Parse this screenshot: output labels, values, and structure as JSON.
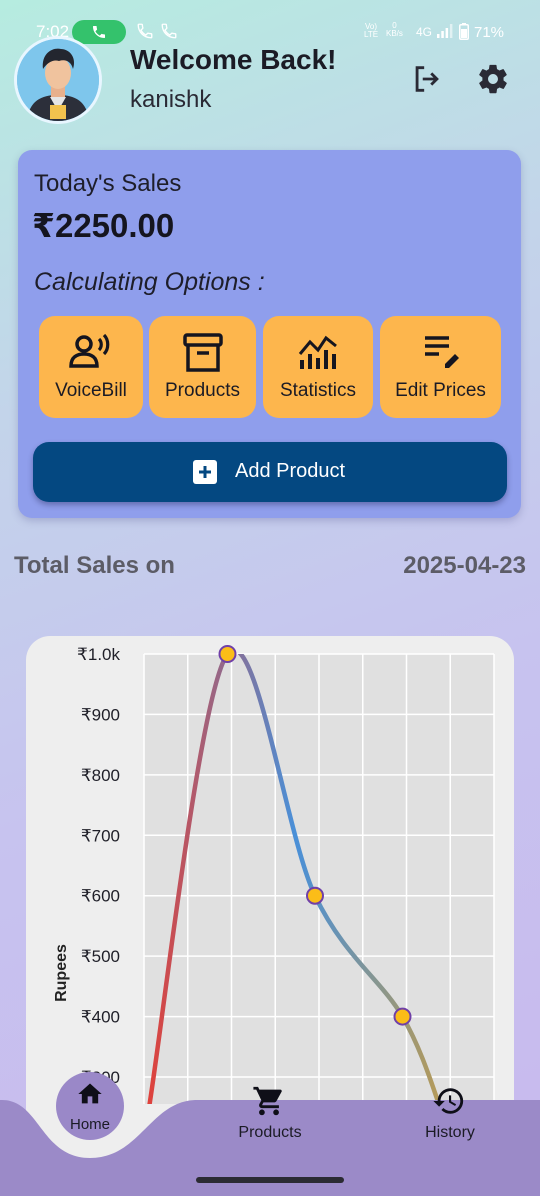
{
  "status_bar": {
    "time": "7:02",
    "network_top": "Vo)",
    "network_bottom": "LTE",
    "speed_value": "0",
    "speed_unit": "KB/s",
    "signal": "4G",
    "battery": "71%"
  },
  "header": {
    "welcome": "Welcome Back!",
    "username": "kanishk",
    "icons": [
      "logout-icon",
      "gear-icon"
    ]
  },
  "sales_card": {
    "title": "Today's Sales",
    "amount": "₹2250.00",
    "options_label": "Calculating Options :",
    "options": [
      {
        "label": "VoiceBill",
        "icon": "voice-icon"
      },
      {
        "label": "Products",
        "icon": "archive-box-icon"
      },
      {
        "label": "Statistics",
        "icon": "chart-icon"
      },
      {
        "label": "Edit Prices",
        "icon": "edit-list-icon"
      }
    ],
    "add_product_label": "Add Product"
  },
  "total_sales": {
    "label": "Total Sales on",
    "date": "2025-04-23"
  },
  "chart_data": {
    "type": "line",
    "ylabel": "Rupees",
    "ytick_labels": [
      "₹1.0k",
      "₹900",
      "₹800",
      "₹700",
      "₹600",
      "₹500",
      "₹400",
      "₹300"
    ],
    "ylim": [
      280,
      1000
    ],
    "x": [
      0,
      1,
      2,
      3,
      4
    ],
    "values": [
      280,
      1000,
      600,
      400,
      280
    ],
    "marked_points": [
      1,
      2,
      3
    ],
    "grid": true,
    "colors": {
      "line_start": "#e0413a",
      "line_mid": "#4a90d8",
      "line_end": "#b79a56",
      "point_fill": "#fbbd18",
      "point_stroke": "#7040a8"
    }
  },
  "bottom_nav": {
    "items": [
      {
        "label": "Home",
        "icon": "home-icon"
      },
      {
        "label": "Products",
        "icon": "cart-icon"
      },
      {
        "label": "History",
        "icon": "history-icon"
      }
    ],
    "bar_color": "#9b8ac8"
  }
}
